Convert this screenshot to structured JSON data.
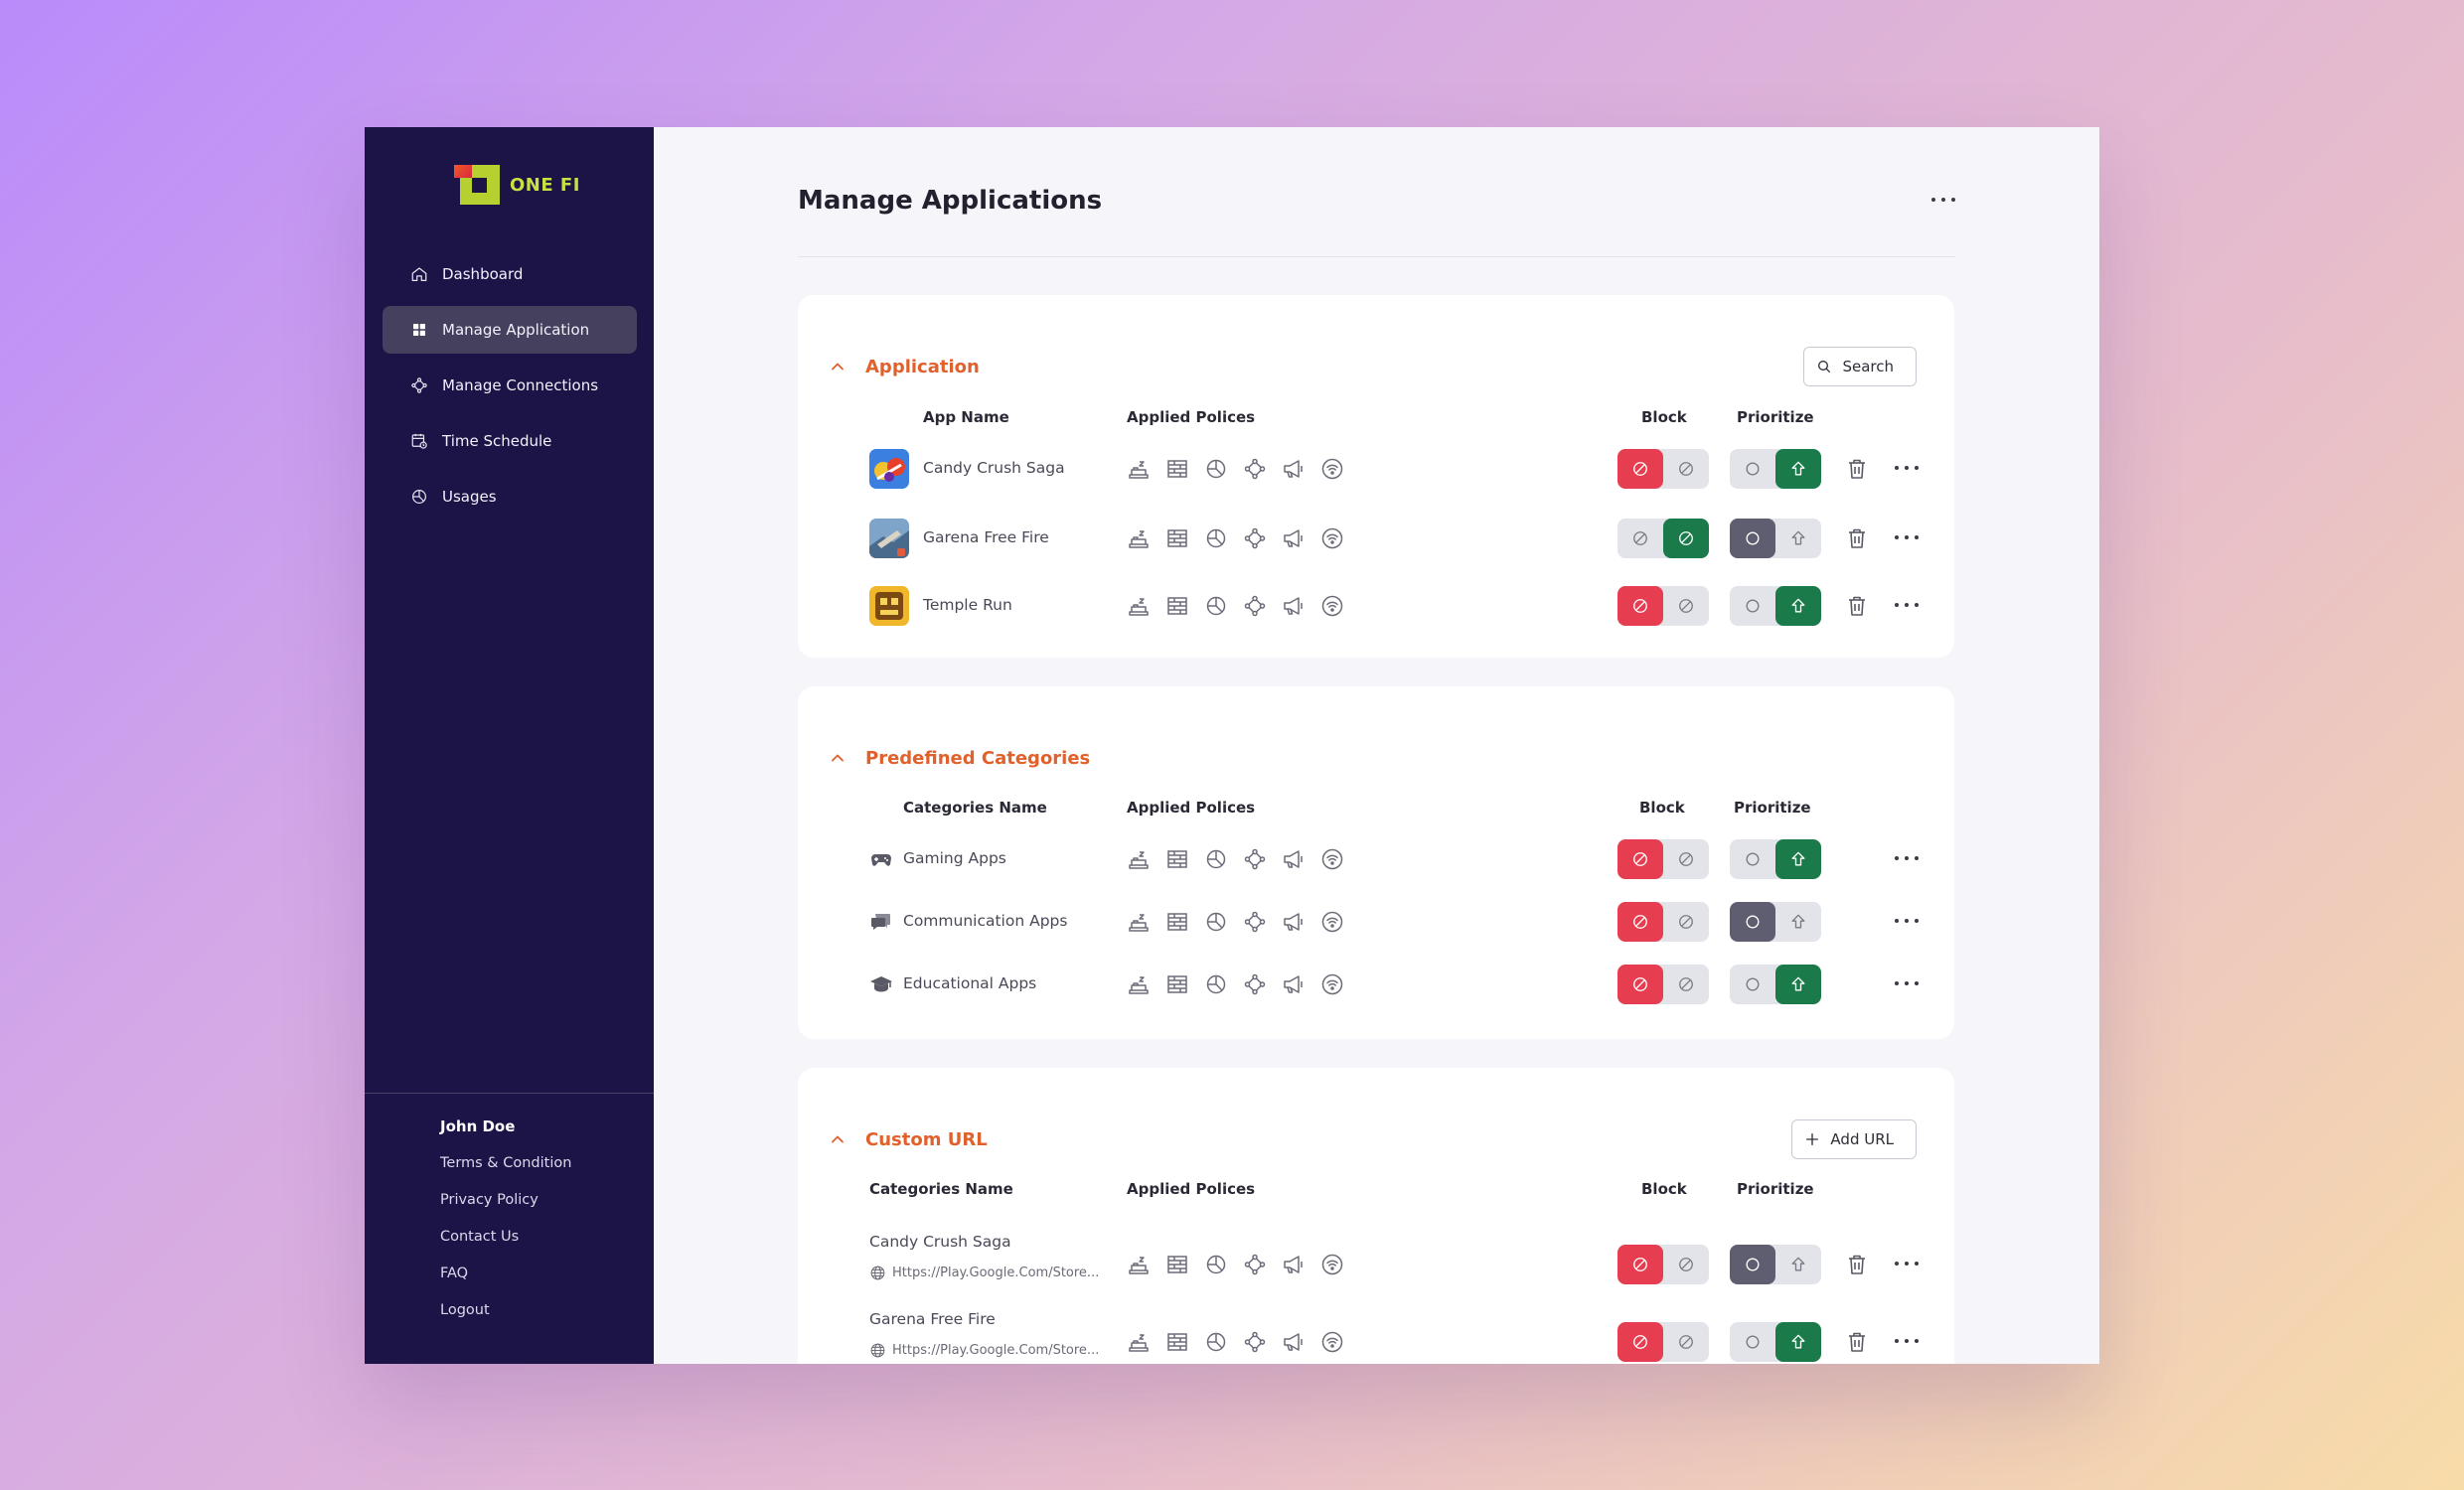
{
  "brand": {
    "name": "ONE FI"
  },
  "sidebar": {
    "items": [
      {
        "label": "Dashboard",
        "icon": "home-icon"
      },
      {
        "label": "Manage Application",
        "icon": "grid-icon",
        "active": true
      },
      {
        "label": "Manage Connections",
        "icon": "connections-icon"
      },
      {
        "label": "Time Schedule",
        "icon": "calendar-icon"
      },
      {
        "label": "Usages",
        "icon": "pie-chart-icon"
      }
    ],
    "user": "John Doe",
    "links": [
      "Terms & Condition",
      "Privacy Policy",
      "Contact Us",
      "FAQ",
      "Logout"
    ]
  },
  "page": {
    "title": "Manage Applications"
  },
  "columns": {
    "app_name": "App Name",
    "categories_name": "Categories Name",
    "applied_policies": "Applied Polices",
    "block": "Block",
    "prioritize": "Prioritize"
  },
  "policy_icons": [
    "sleep-icon",
    "firewall-icon",
    "pie-chart-icon",
    "connections-icon",
    "megaphone-icon",
    "wifi-icon"
  ],
  "sections": {
    "application": {
      "title": "Application",
      "action": "Search",
      "rows": [
        {
          "name": "Candy Crush Saga",
          "block": "blocked",
          "prioritize": "prioritized"
        },
        {
          "name": "Garena Free Fire",
          "block": "allowed",
          "prioritize": "normal"
        },
        {
          "name": "Temple Run",
          "block": "blocked",
          "prioritize": "prioritized"
        }
      ]
    },
    "predefined": {
      "title": "Predefined Categories",
      "rows": [
        {
          "name": "Gaming Apps",
          "icon": "gamepad-icon",
          "block": "blocked",
          "prioritize": "prioritized"
        },
        {
          "name": "Communication Apps",
          "icon": "chat-icon",
          "block": "blocked",
          "prioritize": "normal"
        },
        {
          "name": "Educational Apps",
          "icon": "graduation-cap-icon",
          "block": "blocked",
          "prioritize": "prioritized"
        }
      ]
    },
    "custom_url": {
      "title": "Custom URL",
      "action": "Add URL",
      "rows": [
        {
          "name": "Candy Crush Saga",
          "url": "Https://Play.Google.Com/Store...",
          "block": "blocked",
          "prioritize": "normal"
        },
        {
          "name": "Garena Free Fire",
          "url": "Https://Play.Google.Com/Store...",
          "block": "blocked",
          "prioritize": "prioritized"
        }
      ]
    }
  },
  "colors": {
    "sidebar_bg": "#1c1446",
    "accent_orange": "#e0612c",
    "block_red": "#e63e50",
    "prioritize_green": "#1a7a4a",
    "neutral_gray": "#5f5e70"
  }
}
